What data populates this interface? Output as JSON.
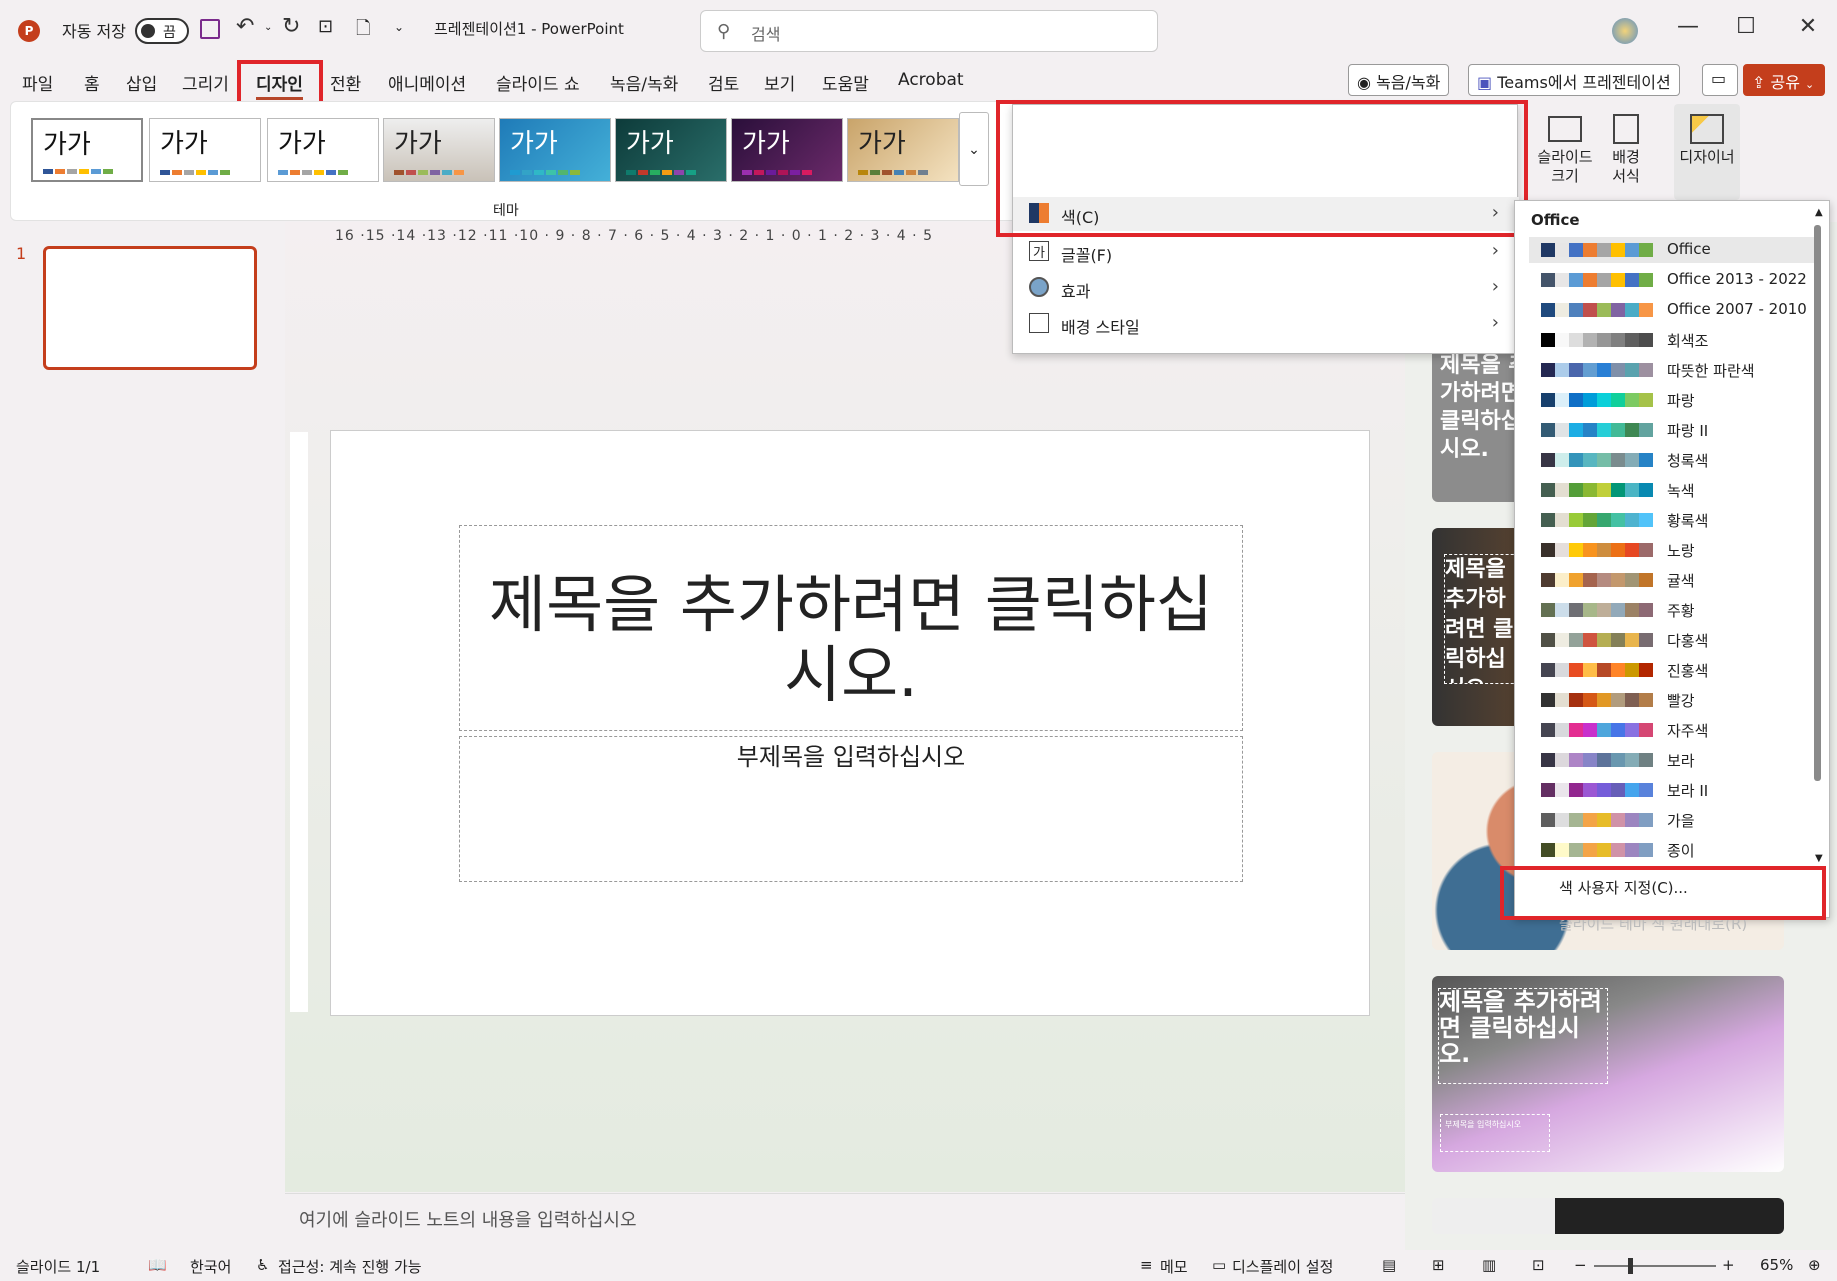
{
  "titlebar": {
    "autosave_label": "자동 저장",
    "autosave_state": "끔",
    "doc_title": "프레젠테이션1  -  PowerPoint",
    "search_placeholder": "검색",
    "minimize": "—",
    "maximize": "☐",
    "close": "✕"
  },
  "tabs": [
    "파일",
    "홈",
    "삽입",
    "그리기",
    "디자인",
    "전환",
    "애니메이션",
    "슬라이드 쇼",
    "녹음/녹화",
    "검토",
    "보기",
    "도움말",
    "Acrobat"
  ],
  "tab_actions": {
    "record": "녹음/녹화",
    "teams": "Teams에서 프레젠테이션",
    "share": "공유"
  },
  "ribbon": {
    "theme_sample": "가가",
    "themes_group_label": "테마",
    "slide_size": "슬라이드 크기",
    "format_background": "배경 서식",
    "designer": "디자이너"
  },
  "theme_colors": [
    [
      "#2f5597",
      "#ed7d31",
      "#a5a5a5",
      "#ffc000",
      "#5b9bd5",
      "#70ad47"
    ],
    [
      "#2f5597",
      "#ed7d31",
      "#a5a5a5",
      "#ffc000",
      "#5b9bd5",
      "#70ad47"
    ],
    [
      "#5b9bd5",
      "#ed7d31",
      "#a5a5a5",
      "#ffc000",
      "#4472c4",
      "#70ad47"
    ],
    [
      "#a0522d",
      "#c0504d",
      "#9bbb59",
      "#8064a2",
      "#4bacc6",
      "#f79646"
    ],
    [
      "#1f9bd1",
      "#33a3c7",
      "#2fb8c7",
      "#3dc3a8",
      "#52b56e",
      "#8ab83a"
    ],
    [
      "#0f7b6c",
      "#c0392b",
      "#27ae60",
      "#f39c12",
      "#8e44ad",
      "#16a085"
    ],
    [
      "#9b2fae",
      "#c2185b",
      "#6a1b9a",
      "#ad1457",
      "#7b1fa2",
      "#d81b60"
    ],
    [
      "#b8860b",
      "#5b7f3a",
      "#a0522d",
      "#4682b4",
      "#cd853f",
      "#708090"
    ]
  ],
  "variant_colors": [
    [
      "#2f5597",
      "#ed7d31",
      "#a5a5a5",
      "#ffc000",
      "#5b9bd5",
      "#70ad47"
    ],
    [
      "#2e7d32",
      "#1565c0",
      "#c62828",
      "#f9a825",
      "#6a1b9a",
      "#00838f"
    ],
    [
      "#2f5597",
      "#ed7d31",
      "#a5a5a5",
      "#ffc000",
      "#5b9bd5",
      "#70ad47"
    ],
    [
      "#2e7d32",
      "#1565c0",
      "#c62828",
      "#f9a825",
      "#6a1b9a",
      "#00838f"
    ]
  ],
  "variant_menu": {
    "items": [
      "색(C)",
      "글꼴(F)",
      "효과",
      "배경 스타일"
    ]
  },
  "colors_submenu": {
    "header": "Office",
    "schemes": [
      {
        "name": "Office",
        "colors": [
          "#1f3864",
          "#e7e6e6",
          "#4472c4",
          "#ed7d31",
          "#a5a5a5",
          "#ffc000",
          "#5b9bd5",
          "#70ad47"
        ]
      },
      {
        "name": "Office 2013 - 2022",
        "colors": [
          "#44546a",
          "#e7e6e6",
          "#5b9bd5",
          "#ed7d31",
          "#a5a5a5",
          "#ffc000",
          "#4472c4",
          "#70ad47"
        ]
      },
      {
        "name": "Office 2007 - 2010",
        "colors": [
          "#1f497d",
          "#eeece1",
          "#4f81bd",
          "#c0504d",
          "#9bbb59",
          "#8064a2",
          "#4bacc6",
          "#f79646"
        ]
      },
      {
        "name": "회색조",
        "colors": [
          "#000000",
          "#f8f8f8",
          "#dddddd",
          "#b2b2b2",
          "#969696",
          "#808080",
          "#5f5f5f",
          "#4d4d4d"
        ]
      },
      {
        "name": "따뜻한 파란색",
        "colors": [
          "#242852",
          "#acccea",
          "#4a66ac",
          "#629dd1",
          "#297fd5",
          "#7f8fa9",
          "#5aa2ae",
          "#9d90a0"
        ]
      },
      {
        "name": "파랑",
        "colors": [
          "#17406d",
          "#dbeff9",
          "#0f6fc6",
          "#009dd9",
          "#0bd0d9",
          "#10cf9b",
          "#7cca62",
          "#a5c249"
        ]
      },
      {
        "name": "파랑 II",
        "colors": [
          "#335b74",
          "#dfe3e5",
          "#1cade4",
          "#2683c6",
          "#27ced7",
          "#42ba97",
          "#3e8853",
          "#62a39f"
        ]
      },
      {
        "name": "청록색",
        "colors": [
          "#373545",
          "#ceedeb",
          "#3494ba",
          "#58b6c0",
          "#75bda7",
          "#7a8c8e",
          "#84acb6",
          "#2683c6"
        ]
      },
      {
        "name": "녹색",
        "colors": [
          "#455f51",
          "#e3ded1",
          "#549e39",
          "#8ab833",
          "#c0cf3a",
          "#029676",
          "#4ab5c4",
          "#0989b1"
        ]
      },
      {
        "name": "황록색",
        "colors": [
          "#455f51",
          "#e3ded1",
          "#99cb38",
          "#63a537",
          "#37a76f",
          "#44c1a3",
          "#4eb3cf",
          "#51c3f9"
        ]
      },
      {
        "name": "노랑",
        "colors": [
          "#39302a",
          "#e5dedb",
          "#ffca08",
          "#f8931d",
          "#ce8d3e",
          "#ec7016",
          "#e64823",
          "#9c6a6a"
        ]
      },
      {
        "name": "귤색",
        "colors": [
          "#4e3b30",
          "#fbeec9",
          "#f0a22e",
          "#a5644e",
          "#b58b80",
          "#c3986d",
          "#a19574",
          "#c17529"
        ]
      },
      {
        "name": "주황",
        "colors": [
          "#637052",
          "#ccddea",
          "#6f6f74",
          "#a7b789",
          "#beae98",
          "#92a9b9",
          "#9c8265",
          "#8d6974"
        ]
      },
      {
        "name": "다홍색",
        "colors": [
          "#505046",
          "#eeece1",
          "#93a299",
          "#cf543f",
          "#b5ae53",
          "#848058",
          "#e8b54d",
          "#786c71"
        ]
      },
      {
        "name": "진홍색",
        "colors": [
          "#454551",
          "#d8d9dc",
          "#e84c22",
          "#ffbd47",
          "#b64926",
          "#ff8427",
          "#cc9900",
          "#b22600"
        ]
      },
      {
        "name": "빨강",
        "colors": [
          "#323232",
          "#e3ded1",
          "#a5300f",
          "#d55816",
          "#e19825",
          "#b19c7d",
          "#7f5f52",
          "#b27d49"
        ]
      },
      {
        "name": "자주색",
        "colors": [
          "#454551",
          "#d8d9dc",
          "#e32d91",
          "#c830cc",
          "#4ea6dc",
          "#4775e7",
          "#8971e1",
          "#d54773"
        ]
      },
      {
        "name": "보라",
        "colors": [
          "#373545",
          "#dcd8dc",
          "#ad84c6",
          "#8784c7",
          "#5d739a",
          "#6997af",
          "#84acb6",
          "#6f8183"
        ]
      },
      {
        "name": "보라 II",
        "colors": [
          "#632e62",
          "#eae5eb",
          "#92278f",
          "#9b57d3",
          "#755dd9",
          "#665eb8",
          "#45a5ed",
          "#5982db"
        ]
      },
      {
        "name": "가을",
        "colors": [
          "#5e5e5e",
          "#ddddde",
          "#a5b592",
          "#f3a447",
          "#e7bc29",
          "#d092a7",
          "#9c85c0",
          "#809ec2"
        ]
      },
      {
        "name": "종이",
        "colors": [
          "#444d26",
          "#fefac9",
          "#a5b592",
          "#f3a447",
          "#e7bc29",
          "#d092a7",
          "#9c85c0",
          "#809ec2"
        ]
      }
    ],
    "customize": "색 사용자 지정(C)...",
    "reset": "슬라이드 테마 색 원래대로(R)"
  },
  "slide_panel": {
    "number": "1"
  },
  "slide": {
    "title_placeholder": "제목을 추가하려면 클릭하십시오.",
    "subtitle_placeholder": "부제목을 입력하십시오"
  },
  "notes_placeholder": "여기에 슬라이드 노트의 내용을 입력하십시오",
  "designer_cards": {
    "card1_title": "제목을 추가하려면 클릭하십시오.",
    "card2_title": "제목을 추가하려면 클릭하십시오.",
    "card4_title": "제목을 추가하려면 클릭하십시오.",
    "card_subtitle": "부제목을 입력하십시오"
  },
  "status": {
    "slide_count": "슬라이드 1/1",
    "language": "한국어",
    "accessibility": "접근성: 계속 진행 가능",
    "notes": "메모",
    "display": "디스플레이 설정",
    "zoom": "65%"
  }
}
